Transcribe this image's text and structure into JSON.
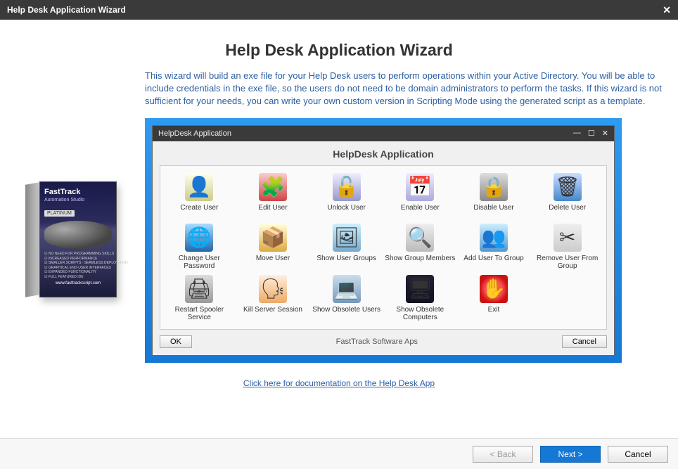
{
  "outer": {
    "title": "Help Desk Application Wizard",
    "close": "✕"
  },
  "heading": "Help Desk Application Wizard",
  "intro": "This wizard will build an exe file for your Help Desk users to perform operations within your Active Directory. You will be able to include credentials in the exe file, so the users do not need to be domain administrators to perform the tasks. If this wizard is not sufficient for your needs, you can write your own custom version in Scripting Mode using the generated script as a template.",
  "productBox": {
    "brand": "FastTrack",
    "subtitle": "Automation Studio",
    "edition": "PLATINUM",
    "features": [
      "☑ NO NEED FOR PROGRAMMING SKILLS",
      "☑ INCREASED PERFORMANCE",
      "☑ SMALLER SCRIPTS - SEAMLESS DEPLOYMENT",
      "☑ GRAPHICAL END-USER INTERFACES",
      "☑ EXPANDED FUNCTIONALITY",
      "☑ FULL FEATURED IDE"
    ],
    "url": "www.fasttrackscript.com"
  },
  "inner": {
    "title": "HelpDesk Application",
    "heading": "HelpDesk Application",
    "wbtns": {
      "min": "—",
      "max": "☐",
      "close": "✕"
    },
    "items": [
      {
        "label": "Create User",
        "glyph": "👤",
        "cls": "ic-create"
      },
      {
        "label": "Edit User",
        "glyph": "🧩",
        "cls": "ic-edit"
      },
      {
        "label": "Unlock User",
        "glyph": "🔓",
        "cls": "ic-unlock"
      },
      {
        "label": "Enable User",
        "glyph": "📅",
        "cls": "ic-enable"
      },
      {
        "label": "Disable User",
        "glyph": "🔒",
        "cls": "ic-disable"
      },
      {
        "label": "Delete User",
        "glyph": "🗑",
        "cls": "ic-delete"
      },
      {
        "label": "Change User Password",
        "glyph": "🌐",
        "cls": "ic-chpw"
      },
      {
        "label": "Move User",
        "glyph": "📦",
        "cls": "ic-move"
      },
      {
        "label": "Show User Groups",
        "glyph": "🖼",
        "cls": "ic-sgroups"
      },
      {
        "label": "Show Group Members",
        "glyph": "🔍",
        "cls": "ic-sgmem"
      },
      {
        "label": "Add User To Group",
        "glyph": "👥",
        "cls": "ic-addg"
      },
      {
        "label": "Remove User From Group",
        "glyph": "✂",
        "cls": "ic-remg"
      },
      {
        "label": "Restart Spooler Service",
        "glyph": "🖨",
        "cls": "ic-spool"
      },
      {
        "label": "Kill Server Session",
        "glyph": "🗣",
        "cls": "ic-kill"
      },
      {
        "label": "Show Obsolete Users",
        "glyph": "💻",
        "cls": "ic-obsU"
      },
      {
        "label": "Show Obsolete Computers",
        "glyph": "🖥",
        "cls": "ic-obsC"
      },
      {
        "label": "Exit",
        "glyph": "✋",
        "cls": "ic-exit"
      }
    ],
    "okLabel": "OK",
    "footerText": "FastTrack Software Aps",
    "cancelLabel": "Cancel"
  },
  "docLink": "Click here for documentation on the Help Desk App",
  "buttons": {
    "back": "< Back",
    "next": "Next >",
    "cancel": "Cancel"
  }
}
